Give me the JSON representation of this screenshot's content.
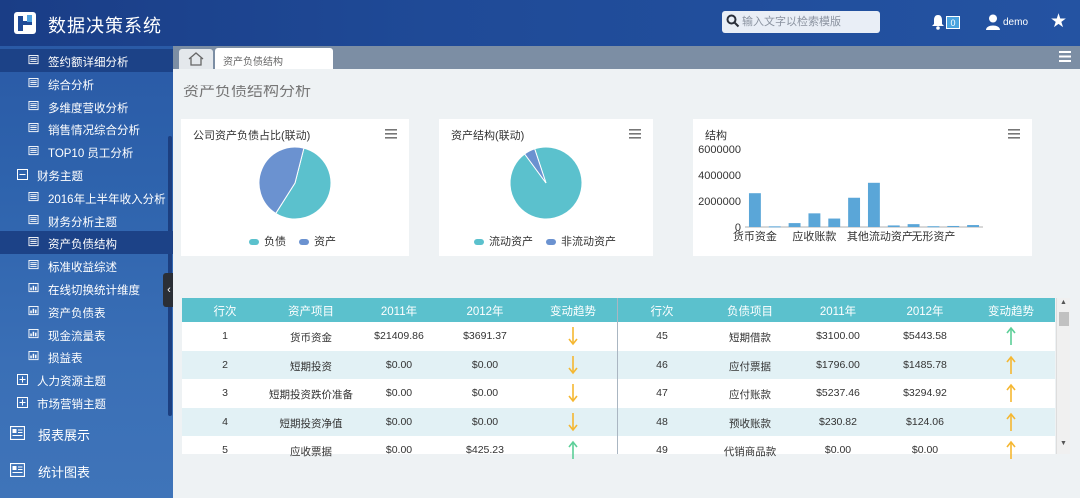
{
  "header": {
    "app_title": "数据决策系统",
    "search_placeholder": "输入文字以检索模版",
    "notification_count": "0",
    "username": "demo",
    "brand_color": "#1f4a97"
  },
  "sidebar": {
    "items": [
      {
        "label": "签约额详细分析",
        "type": "sub",
        "icon": "table-icon",
        "active": true
      },
      {
        "label": "综合分析",
        "type": "sub",
        "icon": "table-icon"
      },
      {
        "label": "多维度营收分析",
        "type": "sub",
        "icon": "table-icon"
      },
      {
        "label": "销售情况综合分析",
        "type": "sub",
        "icon": "table-icon"
      },
      {
        "label": "TOP10 员工分析",
        "type": "sub",
        "icon": "table-icon"
      },
      {
        "label": "财务主题",
        "type": "group",
        "icon": "collapse-icon"
      },
      {
        "label": "2016年上半年收入分析",
        "type": "sub",
        "icon": "table-icon"
      },
      {
        "label": "财务分析主题",
        "type": "sub",
        "icon": "table-icon"
      },
      {
        "label": "资产负债结构",
        "type": "sub",
        "icon": "table-icon",
        "active": true
      },
      {
        "label": "标准收益综述",
        "type": "sub",
        "icon": "table-icon"
      },
      {
        "label": "在线切换统计维度",
        "type": "sub",
        "icon": "chart-icon"
      },
      {
        "label": "资产负债表",
        "type": "sub",
        "icon": "chart-icon"
      },
      {
        "label": "现金流量表",
        "type": "sub",
        "icon": "chart-icon"
      },
      {
        "label": "损益表",
        "type": "sub",
        "icon": "chart-icon"
      },
      {
        "label": "人力资源主题",
        "type": "group",
        "icon": "expand-icon"
      },
      {
        "label": "市场营销主题",
        "type": "group",
        "icon": "expand-icon"
      }
    ],
    "big_items": [
      {
        "label": "报表展示",
        "icon": "report-icon"
      },
      {
        "label": "统计图表",
        "icon": "statistics-icon"
      }
    ]
  },
  "tabs": {
    "active_tab": "资产负债结构"
  },
  "content": {
    "page_title": "资产负债结构分析"
  },
  "charts": {
    "card1": {
      "title": "公司资产负债占比(联动)",
      "legend": [
        "负债",
        "资产"
      ],
      "colors": [
        "#5bc1cd",
        "#6b92d0"
      ]
    },
    "card2": {
      "title": "资产结构(联动)",
      "legend": [
        "流动资产",
        "非流动资产"
      ],
      "colors": [
        "#5bc1cd",
        "#6b92d0"
      ]
    },
    "card3": {
      "title": "结构",
      "bar_color": "#5aa6d8",
      "yticks": [
        "6000000",
        "4000000",
        "2000000",
        "0"
      ],
      "xticks": [
        "货币资金",
        "应收账款",
        "其他流动资产",
        "无形资产"
      ]
    }
  },
  "chart_data": [
    {
      "type": "pie",
      "title": "公司资产负债占比(联动)",
      "labels": [
        "负债",
        "资产"
      ],
      "values": [
        55,
        45
      ]
    },
    {
      "type": "pie",
      "title": "资产结构(联动)",
      "labels": [
        "流动资产",
        "非流动资产"
      ],
      "values": [
        95,
        5
      ]
    },
    {
      "type": "bar",
      "title": "结构",
      "categories": [
        "货币资金",
        "",
        "应收账款",
        "",
        "",
        "其他流动资产",
        "",
        "",
        "无形资产",
        "",
        "",
        ""
      ],
      "values": [
        2600000,
        50000,
        300000,
        1050000,
        650000,
        2250000,
        3400000,
        120000,
        220000,
        60000,
        80000,
        150000
      ],
      "ylim": [
        0,
        6000000
      ],
      "yticks": [
        0,
        2000000,
        4000000,
        6000000
      ]
    }
  ],
  "asset_table": {
    "headers": [
      "行次",
      "资产项目",
      "2011年",
      "2012年",
      "变动趋势"
    ],
    "rows": [
      {
        "no": "1",
        "item": "货币资金",
        "y2011": "$21409.86",
        "y2012": "$3691.37",
        "trend": "down"
      },
      {
        "no": "2",
        "item": "短期投资",
        "y2011": "$0.00",
        "y2012": "$0.00",
        "trend": "down"
      },
      {
        "no": "3",
        "item": "短期投资跌价准备",
        "y2011": "$0.00",
        "y2012": "$0.00",
        "trend": "down"
      },
      {
        "no": "4",
        "item": "短期投资净值",
        "y2011": "$0.00",
        "y2012": "$0.00",
        "trend": "down"
      },
      {
        "no": "5",
        "item": "应收票据",
        "y2011": "$0.00",
        "y2012": "$425.23",
        "trend": "up-green"
      }
    ]
  },
  "liability_table": {
    "headers": [
      "行次",
      "负债项目",
      "2011年",
      "2012年",
      "变动趋势"
    ],
    "rows": [
      {
        "no": "45",
        "item": "短期借款",
        "y2011": "$3100.00",
        "y2012": "$5443.58",
        "trend": "up-green"
      },
      {
        "no": "46",
        "item": "应付票据",
        "y2011": "$1796.00",
        "y2012": "$1485.78",
        "trend": "up"
      },
      {
        "no": "47",
        "item": "应付账款",
        "y2011": "$5237.46",
        "y2012": "$3294.92",
        "trend": "up"
      },
      {
        "no": "48",
        "item": "预收账款",
        "y2011": "$230.82",
        "y2012": "$124.06",
        "trend": "up"
      },
      {
        "no": "49",
        "item": "代销商品款",
        "y2011": "$0.00",
        "y2012": "$0.00",
        "trend": "up"
      }
    ]
  }
}
